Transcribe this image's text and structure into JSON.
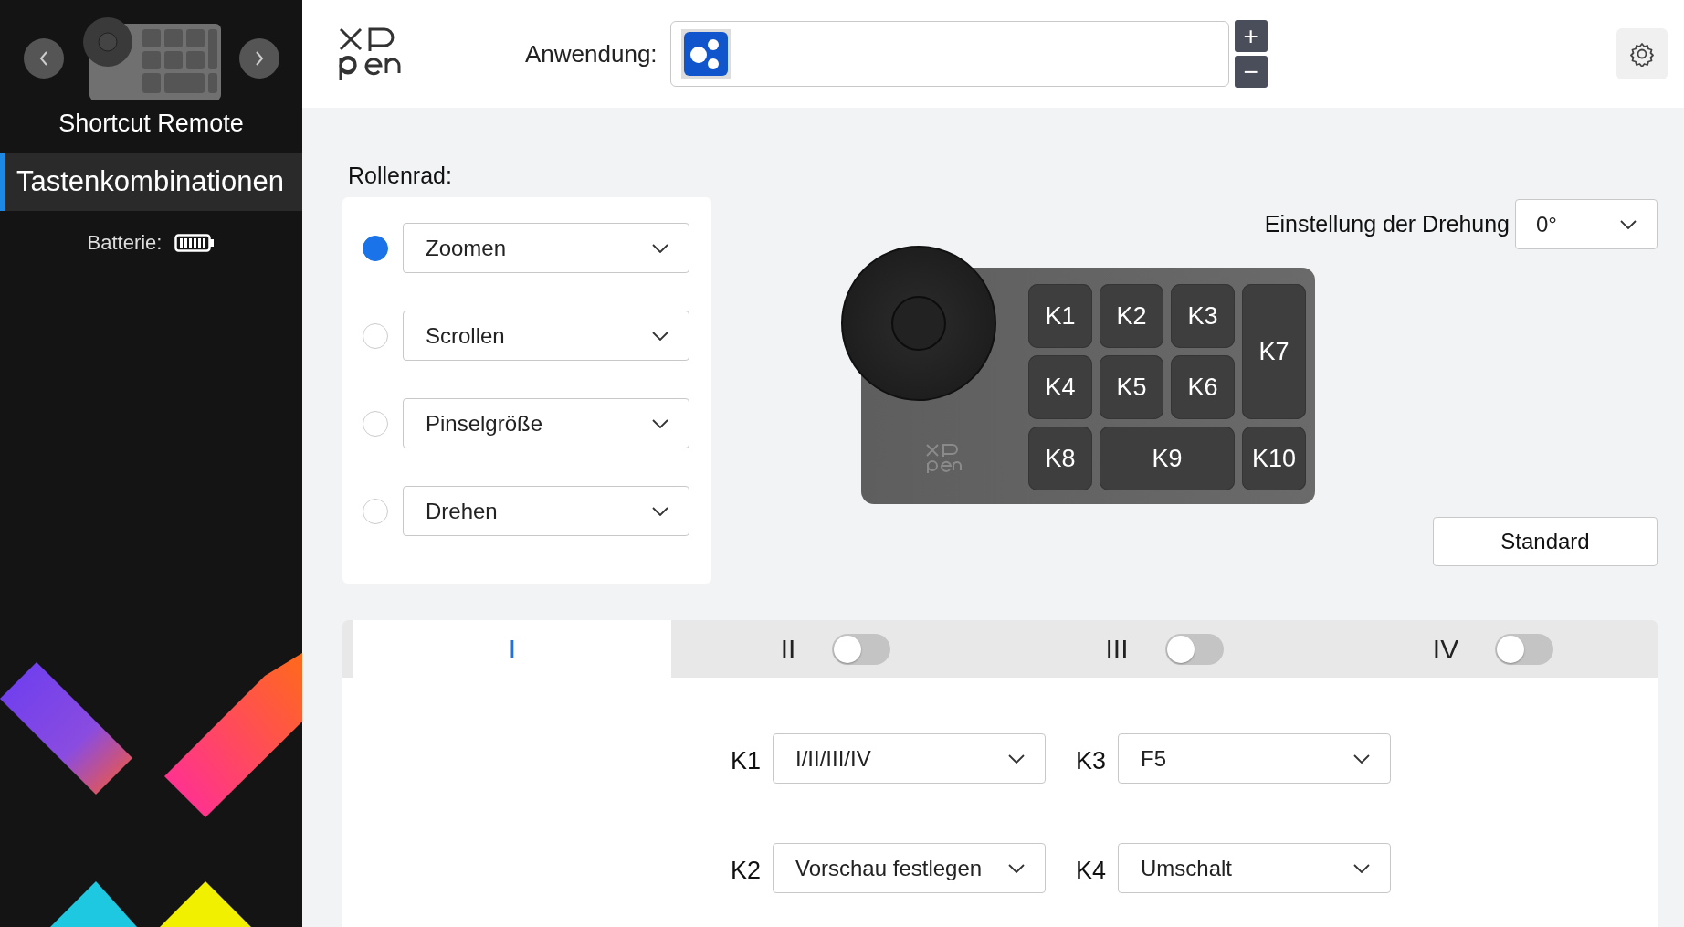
{
  "sidebar": {
    "device_name": "Shortcut Remote",
    "items": [
      {
        "label": "Tastenkombinationen",
        "selected": true
      }
    ],
    "battery_label": "Batterie:"
  },
  "header": {
    "application_label": "Anwendung:",
    "add_button": "+",
    "remove_button": "−"
  },
  "wheel": {
    "title": "Rollenrad:",
    "options": [
      {
        "label": "Zoomen",
        "selected": true
      },
      {
        "label": "Scrollen",
        "selected": false
      },
      {
        "label": "Pinselgröße",
        "selected": false
      },
      {
        "label": "Drehen",
        "selected": false
      }
    ]
  },
  "rotation": {
    "label": "Einstellung der Drehung",
    "value": "0°"
  },
  "device": {
    "keys": [
      "K1",
      "K2",
      "K3",
      "K7",
      "K4",
      "K5",
      "K6",
      "K8",
      "K9",
      "K10"
    ]
  },
  "default_button": "Standard",
  "tabs": [
    {
      "label": "I",
      "selected": true
    },
    {
      "label": "II",
      "selected": false,
      "on": false
    },
    {
      "label": "III",
      "selected": false,
      "on": false
    },
    {
      "label": "IV",
      "selected": false,
      "on": false
    }
  ],
  "key_settings": [
    {
      "key": "K1",
      "value": "I/II/III/IV"
    },
    {
      "key": "K3",
      "value": "F5"
    },
    {
      "key": "K2",
      "value": "Vorschau festlegen"
    },
    {
      "key": "K4",
      "value": "Umschalt"
    }
  ]
}
